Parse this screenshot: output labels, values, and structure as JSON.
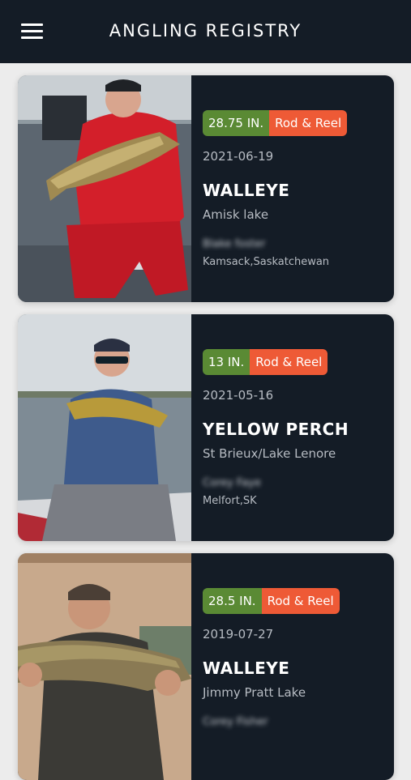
{
  "header": {
    "title": "ANGLING REGISTRY",
    "menu_icon": "hamburger-menu-icon"
  },
  "entries": [
    {
      "length": "28.75 IN.",
      "method": "Rod & Reel",
      "date": "2021-06-19",
      "species": "WALLEYE",
      "lake": "Amisk lake",
      "angler": "Blake foster",
      "region": "Kamsack,Saskatchewan"
    },
    {
      "length": "13 IN.",
      "method": "Rod & Reel",
      "date": "2021-05-16",
      "species": "YELLOW PERCH",
      "lake": "St Brieux/Lake Lenore",
      "angler": "Corey Faye",
      "region": "Melfort,SK"
    },
    {
      "length": "28.5 IN.",
      "method": "Rod & Reel",
      "date": "2019-07-27",
      "species": "WALLEYE",
      "lake": "Jimmy Pratt Lake",
      "angler": "Corey Fisher",
      "region": ""
    }
  ],
  "colors": {
    "header_bg": "#141c26",
    "card_bg": "#141c26",
    "length_tag": "#5a8a34",
    "method_tag": "#ee5a36",
    "page_bg": "#ececec"
  }
}
